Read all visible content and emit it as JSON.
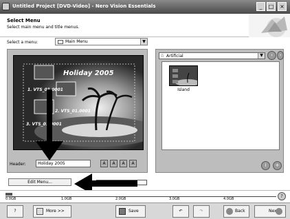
{
  "window": {
    "title": "Untitled Project [DVD-Video] - Nero Vision Essentials"
  },
  "header": {
    "title": "Select Menu",
    "subtitle": "Select main menu and title menus."
  },
  "menu_select": {
    "label": "Select a menu:",
    "value": "Main Menu"
  },
  "preview": {
    "title": "Holiday 2005",
    "items": [
      "1. VTS_01.0001",
      "2. VTS_01.0001",
      "3. VTS_01.0001"
    ]
  },
  "header_field": {
    "label": "Header:",
    "value": "Holiday 2005"
  },
  "edit_menu_label": "Edit Menu...",
  "template_select": {
    "value": "Artificial"
  },
  "templates": [
    {
      "label": "Island"
    }
  ],
  "capacity": {
    "ticks": [
      "0.0GB",
      "1.0GB",
      "2.0GB",
      "3.0GB",
      "4.0GB"
    ],
    "used_fraction": 0.025
  },
  "buttons": {
    "more": "More >>",
    "save": "Save",
    "back": "Back",
    "next": "Next"
  }
}
